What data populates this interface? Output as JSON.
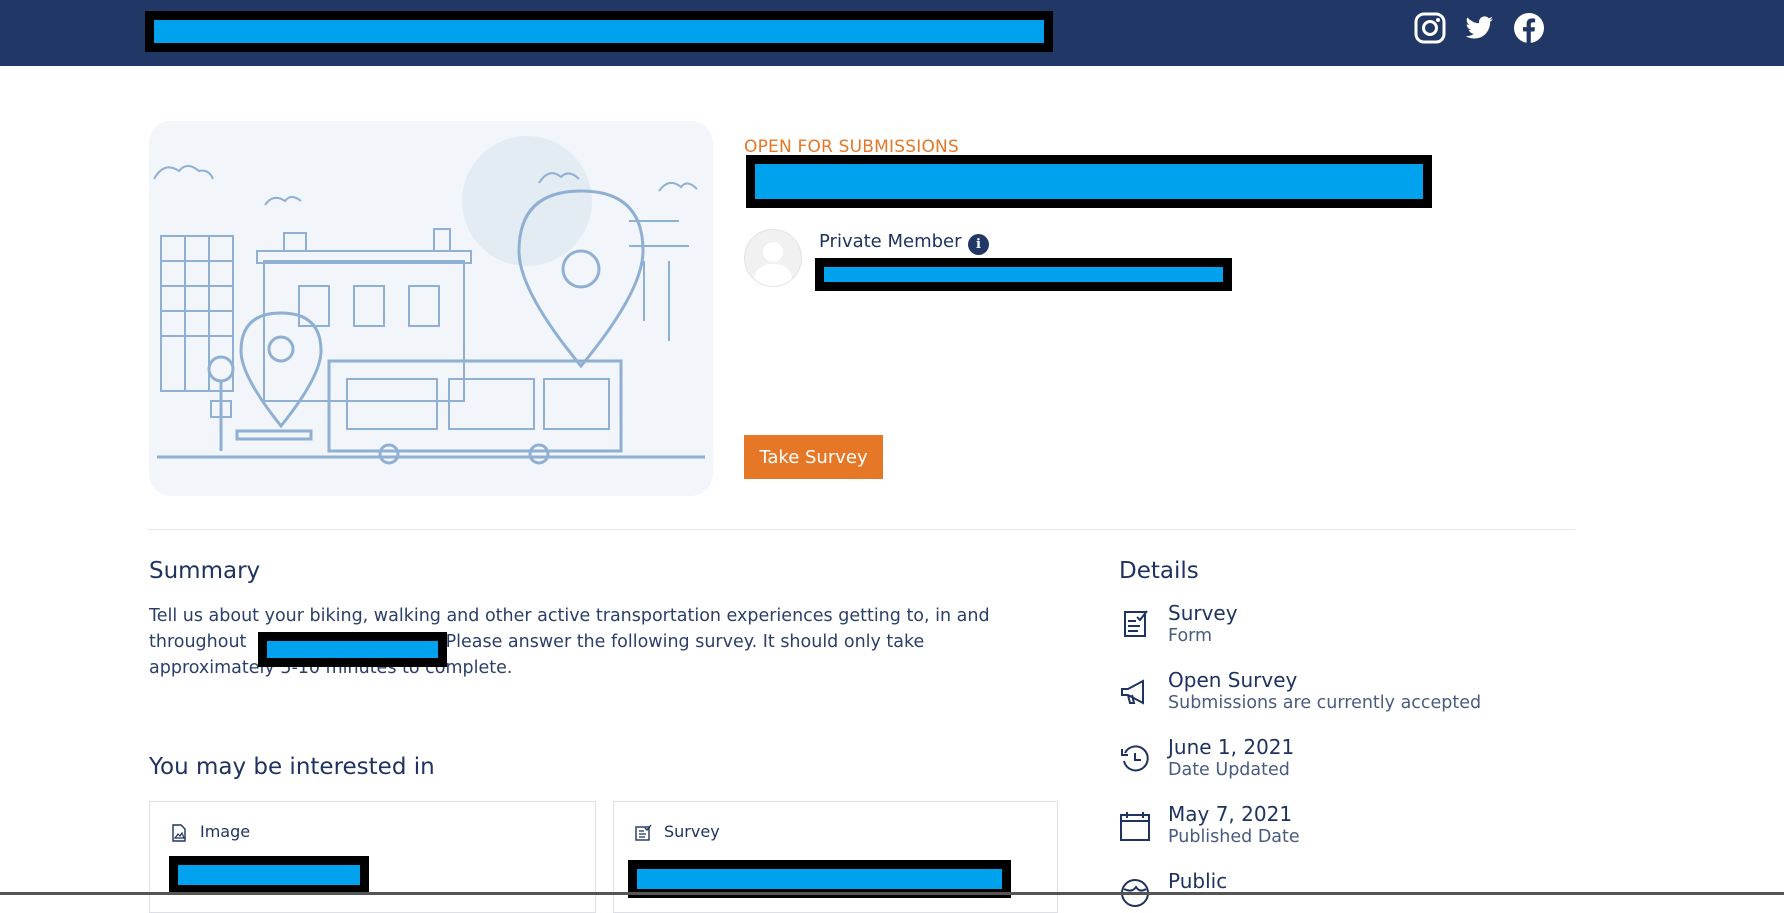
{
  "header": {
    "social": [
      "instagram-icon",
      "twitter-icon",
      "facebook-icon"
    ]
  },
  "hero": {
    "status": "OPEN FOR SUBMISSIONS",
    "member_label": "Private Member",
    "info_glyph": "i",
    "cta_label": "Take Survey"
  },
  "summary": {
    "heading": "Summary",
    "text_part1": "Tell us about your biking, walking and other active transportation experiences getting to, in and throughout",
    "text_part2": "Please answer the following survey. It should only take approximately 5-10 minutes to complete."
  },
  "related": {
    "heading": "You may be interested in",
    "cards": [
      {
        "type": "Image",
        "icon": "image-icon"
      },
      {
        "type": "Survey",
        "icon": "survey-icon"
      }
    ]
  },
  "details": {
    "heading": "Details",
    "items": [
      {
        "title": "Survey",
        "sub": "Form",
        "icon": "form-checklist-icon"
      },
      {
        "title": "Open Survey",
        "sub": "Submissions are currently accepted",
        "icon": "megaphone-icon"
      },
      {
        "title": "June 1, 2021",
        "sub": "Date Updated",
        "icon": "history-icon"
      },
      {
        "title": "May 7, 2021",
        "sub": "Published Date",
        "icon": "calendar-icon"
      },
      {
        "title": "Public",
        "sub": "",
        "icon": "globe-icon"
      }
    ]
  },
  "colors": {
    "header_bg": "#213866",
    "accent": "#e57726",
    "text": "#1f3360",
    "redaction": "#00a2ee"
  }
}
